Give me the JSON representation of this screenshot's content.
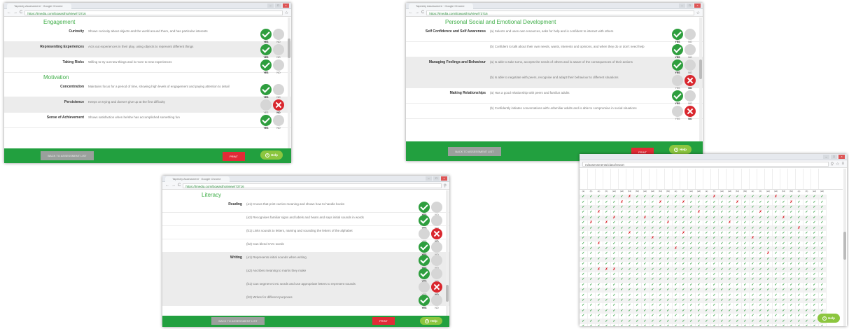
{
  "windows": {
    "w1": {
      "tab": "Tapestry Assessment · Google Chrome",
      "url": "https://tmedia.com/Egwasthra/view/73716",
      "sections": [
        {
          "title": "Engagement",
          "rows": [
            {
              "label": "Curiosity",
              "text": "Shows curiosity about objects and the world around them, and has particular interests",
              "answer": "yes",
              "shade": false
            },
            {
              "label": "Representing Experiences",
              "text": "Acts out experiences in their play, using objects to represent different things",
              "answer": "yes",
              "shade": true
            },
            {
              "label": "Taking Risks",
              "text": "Willing to try out new things and is more to new experiences",
              "answer": "yes",
              "shade": false
            }
          ]
        },
        {
          "title": "Motivation",
          "rows": [
            {
              "label": "Concentration",
              "text": "Maintains focus for a period of time, showing high levels of engagement and paying attention to detail",
              "answer": "yes",
              "shade": false
            },
            {
              "label": "Persistence",
              "text": "Keeps on trying and doesn't give up at the first difficulty",
              "answer": "no",
              "shade": true
            },
            {
              "label": "Sense of Achievement",
              "text": "Shows satisfaction when he/she has accomplished something fun",
              "answer": "yes",
              "shade": false
            }
          ]
        }
      ],
      "back_label": "BACK TO ASSESSMENT LIST",
      "print_label": "PRINT",
      "help_label": "Help"
    },
    "w2": {
      "tab": "Tapestry Assessment · Google Chrome",
      "url": "https://tmedia.com/Egwasthra/view/73716",
      "sections": [
        {
          "title": "Personal Social and Emotional Development",
          "rows": [
            {
              "label": "Self Confidence and Self Awareness",
              "text": "(a) Selects and uses own resources, asks for help and is confident to interact with others",
              "answer": "yes",
              "shade": false
            },
            {
              "label": "",
              "text": "(b) Confident to talk about their own needs, wants, interests and opinions, and when they do or don't need help",
              "answer": "yes",
              "shade": false
            },
            {
              "label": "Managing Feelings and Behaviour",
              "text": "(a) Is able to take turns, accepts the needs of others and is aware of the consequences of their actions",
              "answer": "yes",
              "shade": true
            },
            {
              "label": "",
              "text": "(b) Is able to negotiate with peers, recognise and adapt their behaviour to different situations",
              "answer": "no",
              "shade": true
            },
            {
              "label": "Making Relationships",
              "text": "(a) Has a good relationship with peers and familiar adults",
              "answer": "yes",
              "shade": false
            },
            {
              "label": "",
              "text": "(b) Confidently initiates conversations with unfamiliar adults and is able to compromise in social situations",
              "answer": "no",
              "shade": false
            }
          ]
        }
      ],
      "back_label": "BACK TO ASSESSMENT LIST",
      "print_label": "PRINT",
      "help_label": "Help"
    },
    "w3": {
      "tab": "Tapestry Assessment · Google Chrome",
      "url": "https://tmedia.com/Egwasthra/view/73716",
      "sections": [
        {
          "title": "Literacy",
          "rows": [
            {
              "label": "Reading",
              "text": "(a1) Knows that print carries meaning and shows how to handle books",
              "answer": "yes",
              "shade": false
            },
            {
              "label": "",
              "text": "(a2) Recognises familiar signs and labels and hears and says initial sounds in words",
              "answer": "yes",
              "shade": false
            },
            {
              "label": "",
              "text": "(b1) Links sounds to letters, naming and sounding the letters of the alphabet",
              "answer": "no",
              "shade": false
            },
            {
              "label": "",
              "text": "(b2) Can blend CVC words",
              "answer": "yes",
              "shade": false
            },
            {
              "label": "Writing",
              "text": "(a1) Represents initial sounds when writing",
              "answer": "yes",
              "shade": true
            },
            {
              "label": "",
              "text": "(a2) Ascribes meaning to marks they make",
              "answer": "yes",
              "shade": true
            },
            {
              "label": "",
              "text": "(b1) Can segment CVC words and use appropriate letters to represent sounds",
              "answer": "no",
              "shade": true
            },
            {
              "label": "",
              "text": "(b2) Writes for different purposes",
              "answer": "yes",
              "shade": true
            }
          ]
        }
      ],
      "back_label": "BACK TO ASSESSMENT LIST",
      "print_label": "PRINT",
      "help_label": "Help"
    },
    "w4": {
      "url": "m/assessments/class/report",
      "help_label": "Help"
    }
  },
  "labels": {
    "yes": "YES",
    "no": "NO"
  },
  "grid": {
    "subheaders": [
      "(a)",
      "(b)",
      "(a)",
      "(b)",
      "(a1)",
      "(a2)",
      "(b1)",
      "(b2)",
      "(a1)",
      "(a2)",
      "(b1)",
      "(b2)",
      "(a)",
      "(b)",
      "(a1)",
      "(a2)",
      "(a)",
      "(b)",
      "(a1)",
      "(a2)",
      "(b1)",
      "(b2)",
      "(a)",
      "(b)",
      "(a1)",
      "(a2)",
      "(b1)",
      "(b2)",
      "(a)",
      "(b)",
      "(a1)",
      "(a2)"
    ],
    "rows": [
      "✓✓✓✓✓✓✗✓✓✓✓✓✓✓✓✓✓✗✓✓✓✓✓✓✓✗✓✓✓✓✓✓",
      "✓✓✓✓✓✗✓✓✓✓✗✓✓✗✓✓✓✓✓✓✗✓✓✓✓✓✓✗✓✓✓✓",
      "✓✓✓✓✓✓✓✓✓✓✓✓✓✓✓✓✓✓✓✓✓✓✓✓✓✓✓✓✓✓✓✓",
      "✓✓✗✓✓✓✓✓✓✓✓✓✓✓✓✗✓✓✓✓✓✓✓✗✓✓✓✓✓✓✓✓",
      "✓✓✓✓✗✓✓✓✗✓✓✓✓✓✓✓✓✓✓✓✓✓✓✓✓✓✗✓✓✓✓✓",
      "✓✗✓✗✓✓✓✓✓✓✓✗✓✓✓✓✓✓✓✗✓✓✓✓✓✓✓✓✓✓✓✓",
      "✓✓✓✓✓✓✓✓✓✓✓✓✓✓✓✓✓✓✓✓✓✓✓✓✓✓✓✓✗✓✓✓",
      "✓✓✓✓✓✓✗✓✓✓✓✓✓✗✓✓✓✓✓✓✓✓✓✓✓✓✓✓✓✓✓✓",
      "✓✓✓✓✓✓✓✓✓✗✓✓✓✓✓✓✓✓✓✓✓✓✗✓✓✓✓✓✓✓✓✓",
      "✓✓✗✓✓✓✓✓✓✓✓✓✓✓✓✓✓✓✓✓✓✓✓✓✓✓✓✓✓✓✓✓",
      "✓✓✓✓✓✓✓✓✓✓✓✓✗✓✓✓✓✓✓✓✓✓✓✓✓✓✓✓✓✓✓✓",
      "✓✓✓✓✓✓✓✓✓✓✓✓✓✓✓✓✓✓✓✓✓✓✓✓✗✓✓✓✓✓✓✓",
      "✓✓✓✓✓✓✓✓✓✓✓✓✓✓✓✓✓✓✓✓✓✓✓✓✓✓✓✓✓✓✓✓",
      "✓✓✓✓✓✓✓✓✓✓✓✓✓✓✓✓✓✓✓✓✓✓✓✓✓✓✓✓✓✓✓✓",
      "✓✓✗✗✗✓✓✓✓✓✓✓✓✓✓✓✓✓✓✓✓✓✓✓✓✓✓✓✓✓✓✓",
      "✓✓✓✓✓✓✓✓✓✓✓✓✓✓✓✓✓✓✓✓✓✓✓✓✓✓✓✓✓✓✓✓",
      "✓✓✓✓✓✓✓✓✓✓✓✓✓✓✓✓✓✓✓✓✓✓✓✓✓✓✓✓✓✓✓✓",
      "✓✓✓✓✓✓✓✓✓✓✓✓✓✓✓✓✓✓✓✓✓✓✓✓✓✓✓✓✓✓✓✓",
      "✓✓✓✓✓✓✓✓✓✓✓✓✓✓✓✓✓✓✓✓✓✓✓✓✓✓✓✓✓✓✓✓",
      "✓✓✓✓✓✓✓✓✓✓✓✓✓✓✓✓✓✓✓✓✓✓✓✓✓✓✓✓✓✓✓✓",
      "✓✓✓✓✓✓✓✓✓✓✓✓✓✓✓✓✓✓✓✓✓✓✓✓✓✓✓✓✓✓✓✓",
      "✓✓✓✓✓✓✓✓✓✓✓✓✓✓✓✓✓✓✓✓✓✓✓✓✓✓✓✓✓✓✓✓",
      "✓✓✓✓✓✓✓✓✓✓✓✓✓✓✓✓✓✓✓✓✓✓✓✓✓✓✓✓✓✓✓✓",
      "✓✓✓✓✓✓✓✓✓✓✓✓✓✓✓✓✓✓✓✓✓✓✓✓✓✓✓✓✓✓✓✓",
      "✓✓✓✓✓✓✓✓✓✓✓✓✓✓✓✓✓✓✓✓✓✓✓✓✓✓✓✓✓✓✓✓",
      "✓✓✓✓✓✓✓✓✓✓✓✓✓✓✓✓✓✓✓✓✓✓✓✓✓✓✓✓✓✓✓✓"
    ]
  },
  "colors": {
    "green": "#22a03f",
    "yes": "#2e9e3e",
    "no": "#d9272e",
    "section": "#3fae48"
  }
}
